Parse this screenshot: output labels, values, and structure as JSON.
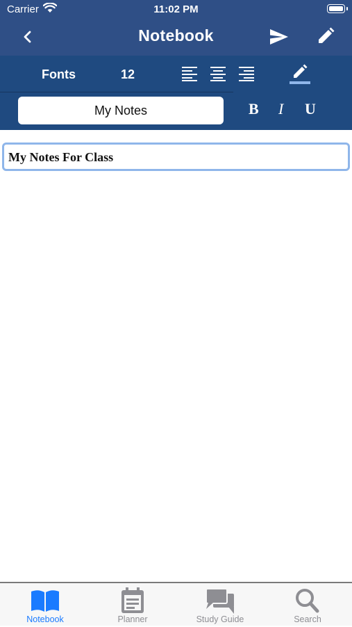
{
  "status_bar": {
    "carrier": "Carrier",
    "time": "11:02 PM"
  },
  "nav": {
    "title": "Notebook"
  },
  "toolbar": {
    "fonts_label": "Fonts",
    "font_size": "12",
    "notebook_name": "My Notes",
    "bold_label": "B",
    "italic_label": "I",
    "underline_label": "U"
  },
  "editor": {
    "note_title": "My Notes For Class"
  },
  "tabs": [
    {
      "label": "Notebook",
      "icon": "book-icon",
      "active": true
    },
    {
      "label": "Planner",
      "icon": "planner-icon",
      "active": false
    },
    {
      "label": "Study Guide",
      "icon": "chat-icon",
      "active": false
    },
    {
      "label": "Search",
      "icon": "search-icon",
      "active": false
    }
  ],
  "colors": {
    "nav_bar": "#2f4f86",
    "toolbar": "#1f4a80",
    "accent": "#1a7bff",
    "inactive_tab": "#8e8e93",
    "editor_border": "#8fb6ea"
  }
}
